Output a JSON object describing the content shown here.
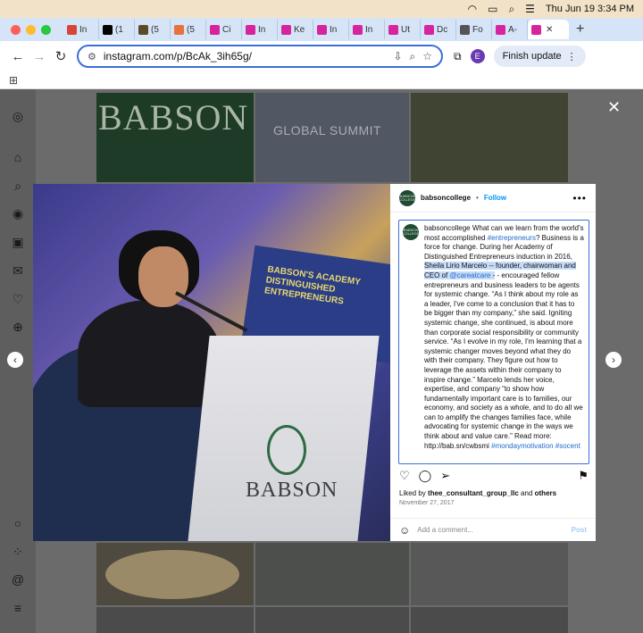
{
  "menubar": {
    "datetime": "Thu Jun 19  3:34 PM",
    "icons": [
      "wifi-icon",
      "battery-icon",
      "search-icon",
      "control-center-icon"
    ]
  },
  "tabs": [
    {
      "label": "In",
      "favicon": "gmail-icon",
      "color": "#d44638"
    },
    {
      "label": "(1",
      "favicon": "x-icon",
      "color": "#000000"
    },
    {
      "label": "(5",
      "favicon": "site-icon",
      "color": "#5a4a2a"
    },
    {
      "label": "(5",
      "favicon": "bookmark-icon",
      "color": "#e8703a"
    },
    {
      "label": "Ci",
      "favicon": "instagram-icon",
      "color": "#d6249f"
    },
    {
      "label": "In",
      "favicon": "instagram-icon",
      "color": "#d6249f"
    },
    {
      "label": "Ke",
      "favicon": "instagram-icon",
      "color": "#d6249f"
    },
    {
      "label": "In",
      "favicon": "instagram-icon",
      "color": "#d6249f"
    },
    {
      "label": "In",
      "favicon": "instagram-icon",
      "color": "#d6249f"
    },
    {
      "label": "Ut",
      "favicon": "instagram-icon",
      "color": "#d6249f"
    },
    {
      "label": "Dc",
      "favicon": "instagram-icon",
      "color": "#d6249f"
    },
    {
      "label": "Fo",
      "favicon": "threads-icon",
      "color": "#555555"
    },
    {
      "label": "A-",
      "favicon": "instagram-icon",
      "color": "#d6249f"
    }
  ],
  "active_tab": {
    "favicon": "instagram-icon",
    "close": "✕"
  },
  "toolbar": {
    "url": "instagram.com/p/BcAk_3ih65g/",
    "profile_initial": "E",
    "finish_update": "Finish update"
  },
  "page": {
    "tile_babson_text": "BABSON",
    "tile_summit_text": "GLOBAL SUMMIT"
  },
  "post": {
    "username": "babsoncollege",
    "follow": "Follow",
    "avatar_text": "BABSON COLLEGE",
    "caption": {
      "p1": "babsoncollege What can we learn from the world's most accomplished ",
      "tag1": "#entrepreneurs",
      "p2": "? Business is a force for change. During her Academy of Distinguished Entrepreneurs induction in 2016, ",
      "sel1": "Sheila Lirio Marcelo -- founder, chairwoman and CEO of ",
      "mention": "@careatcare",
      "sel2": " -",
      "p3": " - encouraged fellow entrepreneurs and business leaders to be agents for systemic change. “As I think about my role as a leader, I've come to a conclusion that it has to be bigger than my company,” she said. Igniting systemic change, she continued, is about more than corporate social responsibility or community service. “As I evolve in my role, I'm learning that a systemic changer moves beyond what they do with their company. They figure out how to leverage the assets within their company to inspire change.” Marcelo lends her voice, expertise, and company “to show how fundamentally important care is to families, our economy, and society as a whole, and to do all we can to amplify the changes families face, while advocating for systemic change in the ways we think about and value care.” Read more: http://bab.sn/cwbsmi ",
      "tag2": "#mondaymotivation",
      "tag3": "#socent"
    },
    "liked_by_prefix": "Liked by ",
    "liked_by_user": "thee_consultant_group_llc",
    "liked_by_and": " and ",
    "liked_by_others": "others",
    "date": "November 27, 2017",
    "comment_placeholder": "Add a comment...",
    "post_button": "Post"
  },
  "photo": {
    "banner_text": "BABSON'S ACADEMY DISTINGUISHED ENTREPRENEURS",
    "podium_text": "BABSON"
  },
  "colors": {
    "accent": "#0095f6",
    "babson_green": "#1f4b31",
    "omnibox_border": "#3b6fd8"
  }
}
